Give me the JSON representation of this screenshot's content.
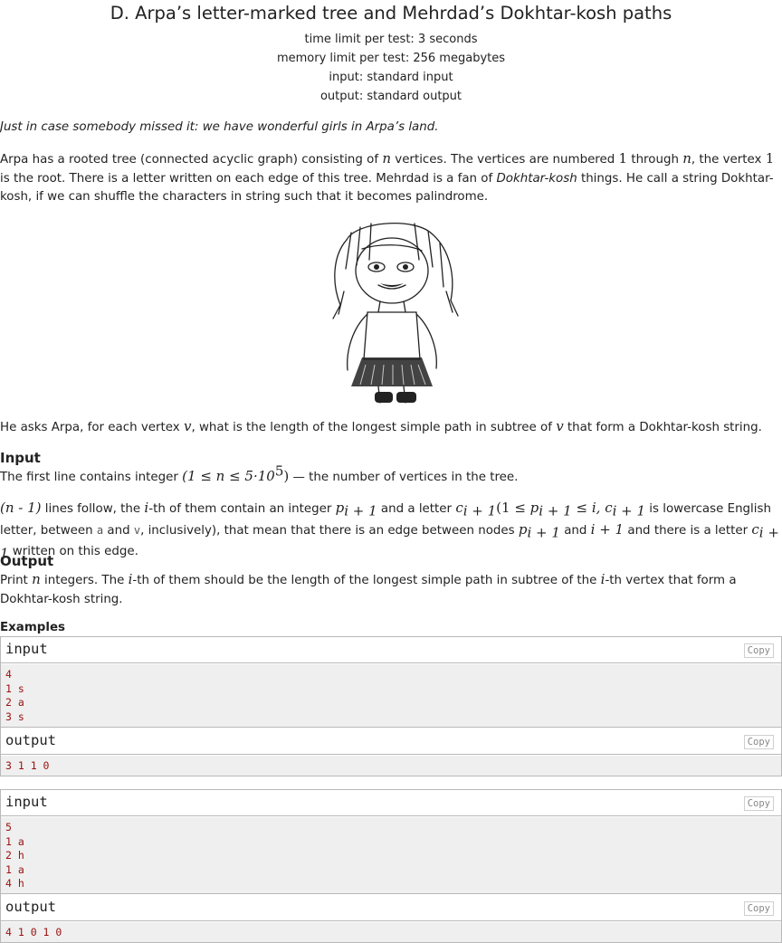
{
  "problem": {
    "title": "D. Arpa’s letter-marked tree and Mehrdad’s Dokhtar-kosh paths",
    "time_limit": "time limit per test: 3 seconds",
    "memory_limit": "memory limit per test: 256 megabytes",
    "input_file": "input: standard input",
    "output_file": "output: standard output"
  },
  "legend": {
    "intro": "Just in case somebody missed it: we have wonderful girls in Arpa’s land.",
    "p1_a": "Arpa has a rooted tree (connected acyclic graph) consisting of ",
    "p1_b": " vertices. The vertices are numbered ",
    "p1_c": " through ",
    "p1_d": ", the vertex ",
    "p1_e": " is the root. There is a letter written on each edge of this tree. Mehrdad is a fan of ",
    "p1_term": "Dokhtar-kosh",
    "p1_f": " things. He call a string Dokhtar-kosh, if we can shuffle the characters in string such that it becomes palindrome.",
    "p2_a": "He asks Arpa, for each vertex ",
    "p2_b": ", what is the length of the longest simple path in subtree of ",
    "p2_c": " that form a Dokhtar-kosh string."
  },
  "math": {
    "n": "n",
    "one": "1",
    "v": "v",
    "i": "i",
    "p": "p",
    "c": "c",
    "sub_i1": "i + 1",
    "n_range": "(1 ≤ n ≤ 5·10",
    "exp5": "5",
    "close": ")",
    "n_minus_1": "(n  -  1)",
    "p_range_open": "(1 ≤ ",
    "le_i": " ≤ i, ",
    "i_plus_1": "i + 1",
    "letter_a": "a",
    "letter_v": "v"
  },
  "input_section": {
    "title": "Input",
    "l1_a": "The first line contains integer ",
    "l1_b": " — the number of vertices in the tree.",
    "l2_a": " lines follow, the ",
    "l2_b": "-th of them contain an integer ",
    "l2_c": " and a letter ",
    "l2_d": " is lowercase English letter, between ",
    "l2_e": " and ",
    "l2_f": ", inclusively), that mean that there is an edge between nodes ",
    "l2_g": " and ",
    "l2_h": " and there is a letter ",
    "l2_i": " written on this edge."
  },
  "output_section": {
    "title": "Output",
    "l1_a": "Print ",
    "l1_b": " integers. The ",
    "l1_c": "-th of them should be the length of the longest simple path in subtree of the ",
    "l1_d": "-th vertex that form a Dokhtar-kosh string."
  },
  "examples": {
    "title": "Examples",
    "input_label": "input",
    "output_label": "output",
    "copy_label": "Copy",
    "tests": [
      {
        "input": [
          "4",
          "1 s",
          "2 a",
          "3 s"
        ],
        "output": [
          "3 1 1 0"
        ]
      },
      {
        "input": [
          "5",
          "1 a",
          "2 h",
          "1 a",
          "4 h"
        ],
        "output": [
          "4 1 0 1 0"
        ]
      }
    ]
  }
}
